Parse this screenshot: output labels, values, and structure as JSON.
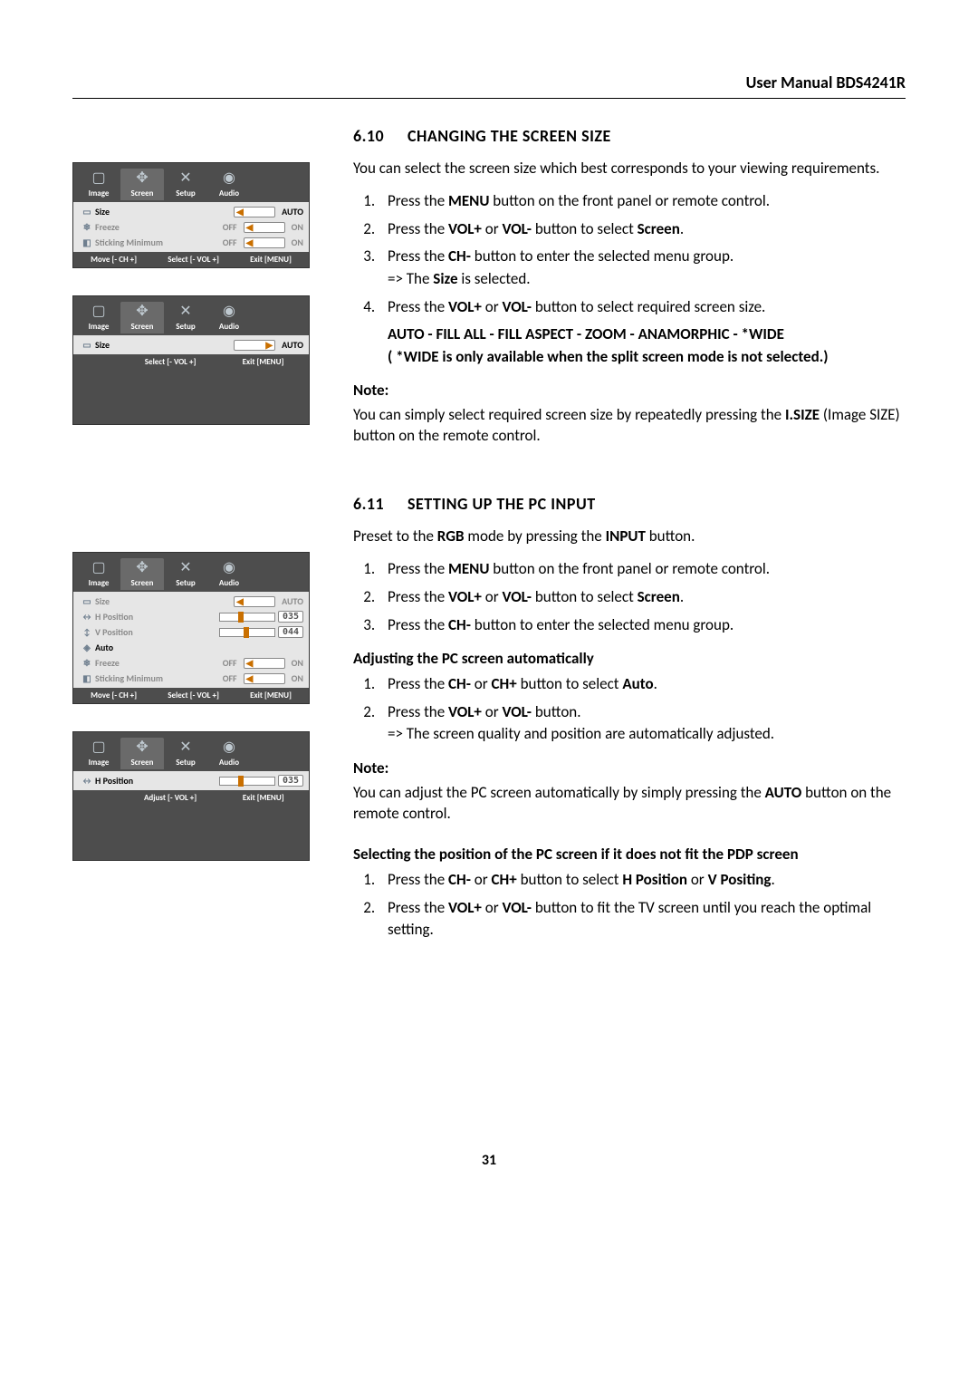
{
  "header": "User Manual BDS4241R",
  "page_number": "31",
  "osd_tabs": {
    "image": "Image",
    "screen": "Screen",
    "setup": "Setup",
    "audio": "Audio"
  },
  "osd1": {
    "rows": {
      "size": {
        "label": "Size",
        "value": "AUTO"
      },
      "freeze": {
        "label": "Freeze",
        "off": "OFF",
        "on": "ON"
      },
      "sticking": {
        "label": "Sticking Minimum",
        "off": "OFF",
        "on": "ON"
      }
    },
    "hints": {
      "move": "Move [- CH +]",
      "select": "Select [- VOL +]",
      "exit": "Exit [MENU]"
    }
  },
  "osd2": {
    "rows": {
      "size": {
        "label": "Size",
        "value": "AUTO"
      }
    },
    "hints": {
      "select": "Select [- VOL +]",
      "exit": "Exit [MENU]"
    }
  },
  "osd3": {
    "rows": {
      "size": {
        "label": "Size",
        "value": "AUTO"
      },
      "hpos": {
        "label": "H Position",
        "value": "035"
      },
      "vpos": {
        "label": "V Position",
        "value": "044"
      },
      "auto": {
        "label": "Auto"
      },
      "freeze": {
        "label": "Freeze",
        "off": "OFF",
        "on": "ON"
      },
      "sticking": {
        "label": "Sticking Minimum",
        "off": "OFF",
        "on": "ON"
      }
    },
    "hints": {
      "move": "Move [- CH +]",
      "select": "Select [- VOL +]",
      "exit": "Exit [MENU]"
    }
  },
  "osd4": {
    "rows": {
      "hpos": {
        "label": "H Position",
        "value": "035"
      }
    },
    "hints": {
      "adjust": "Adjust [- VOL +]",
      "exit": "Exit [MENU]"
    }
  },
  "section610": {
    "num": "6.10",
    "title": "CHANGING THE SCREEN SIZE",
    "intro": "You can select the screen size which best corresponds to your viewing requirements.",
    "step1_a": "Press the ",
    "step1_b": "MENU",
    "step1_c": " button on the front panel or remote control.",
    "step2_a": "Press the ",
    "step2_b": "VOL+",
    "step2_c": " or ",
    "step2_d": "VOL-",
    "step2_e": " button to select ",
    "step2_f": "Screen",
    "step2_g": ".",
    "step3_a": "Press the ",
    "step3_b": "CH-",
    "step3_c": " button to enter the selected menu group.",
    "step3_d": "=> The ",
    "step3_e": "Size",
    "step3_f": " is selected.",
    "step4_a": "Press the ",
    "step4_b": "VOL+",
    "step4_c": " or ",
    "step4_d": "VOL-",
    "step4_e": " button to select required screen size.",
    "modes": "AUTO - FILL ALL - FILL ASPECT - ZOOM - ANAMORPHIC - *WIDE",
    "wide_note": "( *WIDE is only available when the split screen mode is not selected.)",
    "note_h": "Note:",
    "note_a": "You can simply select required screen size by repeatedly pressing the ",
    "note_b": "I.SIZE",
    "note_c": " (Image SIZE) button on the remote control."
  },
  "section611": {
    "num": "6.11",
    "title": "SETTING UP THE PC INPUT",
    "preset_a": "Preset to the ",
    "preset_b": "RGB",
    "preset_c": " mode by pressing the ",
    "preset_d": "INPUT",
    "preset_e": " button.",
    "step1_a": "Press the ",
    "step1_b": "MENU",
    "step1_c": " button on the front panel or remote control.",
    "step2_a": "Press the ",
    "step2_b": "VOL+",
    "step2_c": " or ",
    "step2_d": "VOL-",
    "step2_e": " button to select ",
    "step2_f": "Screen",
    "step2_g": ".",
    "step3_a": "Press the ",
    "step3_b": "CH-",
    "step3_c": " button to enter the selected menu group.",
    "adj_h": "Adjusting the PC screen automatically",
    "adj1_a": "Press the ",
    "adj1_b": "CH-",
    "adj1_c": " or ",
    "adj1_d": "CH+",
    "adj1_e": " button to select ",
    "adj1_f": "Auto",
    "adj1_g": ".",
    "adj2_a": "Press the ",
    "adj2_b": "VOL+",
    "adj2_c": " or ",
    "adj2_d": "VOL-",
    "adj2_e": " button.",
    "adj2_f": "=> The screen quality and position are automatically adjusted.",
    "note_h": "Note:",
    "note_a": "You can adjust the PC screen automatically by simply pressing the ",
    "note_b": "AUTO",
    "note_c": " button on the remote control.",
    "sel_h": "Selecting the position of the PC screen if it does not fit the PDP screen",
    "sel1_a": "Press the ",
    "sel1_b": "CH-",
    "sel1_c": " or ",
    "sel1_d": "CH+",
    "sel1_e": " button to select ",
    "sel1_f": "H Position",
    "sel1_g": " or ",
    "sel1_h": "V Positing",
    "sel1_i": ".",
    "sel2_a": "Press the ",
    "sel2_b": "VOL+",
    "sel2_c": " or ",
    "sel2_d": "VOL-",
    "sel2_e": " button to fit the TV screen until you reach the optimal setting."
  }
}
